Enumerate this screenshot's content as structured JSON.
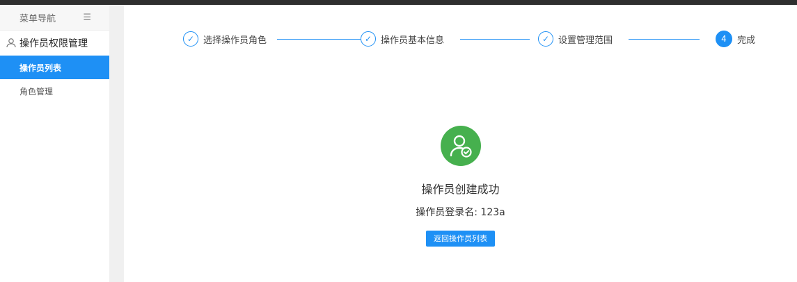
{
  "sidebar": {
    "header_title": "菜单导航",
    "toggle_icon": "☰",
    "group_label": "操作员权限管理",
    "items": [
      {
        "label": "操作员列表",
        "active": true
      },
      {
        "label": "角色管理",
        "active": false
      }
    ]
  },
  "steps": [
    {
      "label": "选择操作员角色",
      "status": "done",
      "mark": "✓"
    },
    {
      "label": "操作员基本信息",
      "status": "done",
      "mark": "✓"
    },
    {
      "label": "设置管理范围",
      "status": "done",
      "mark": "✓"
    },
    {
      "label": "完成",
      "status": "current",
      "mark": "4"
    }
  ],
  "result": {
    "title": "操作员创建成功",
    "login_label": "操作员登录名: 123a",
    "back_button": "返回操作员列表"
  },
  "colors": {
    "accent": "#1e90f5",
    "success": "#46b04e"
  }
}
